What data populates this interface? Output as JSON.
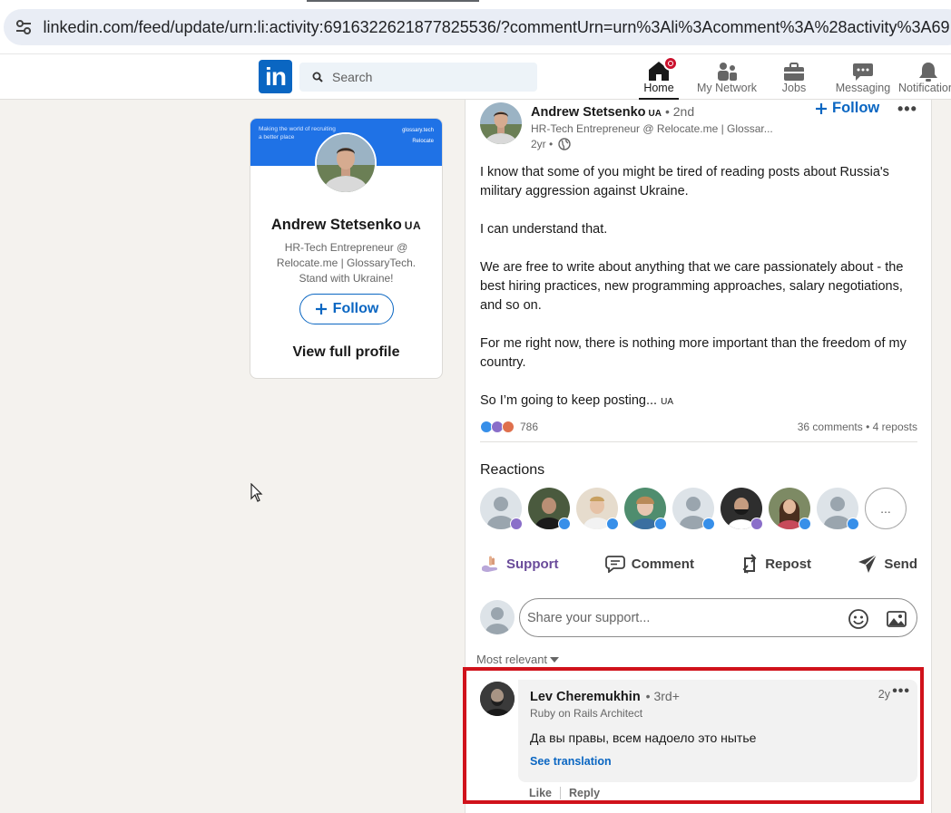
{
  "browser": {
    "url": "linkedin.com/feed/update/urn:li:activity:6916322621877825536/?commentUrn=urn%3Ali%3Acomment%3A%28activity%3A69163"
  },
  "nav": {
    "logo": "in",
    "search_placeholder": "Search",
    "items": [
      {
        "label": "Home",
        "icon": "home-icon",
        "active": true
      },
      {
        "label": "My Network",
        "icon": "network-icon"
      },
      {
        "label": "Jobs",
        "icon": "briefcase-icon"
      },
      {
        "label": "Messaging",
        "icon": "messaging-icon"
      },
      {
        "label": "Notifications",
        "icon": "bell-icon"
      }
    ]
  },
  "profile_card": {
    "banner_left": "Making the world of recruiting a better place",
    "banner_right_top": "glossary.tech",
    "banner_right_bottom": "Relocate",
    "name": "Andrew Stetsenko",
    "flag": "UA",
    "headline": "HR-Tech Entrepreneur @ Relocate.me | GlossaryTech. Stand with Ukraine!",
    "follow_label": "Follow",
    "view_profile_label": "View full profile"
  },
  "post": {
    "author": "Andrew Stetsenko",
    "flag": "UA",
    "degree": "• 2nd",
    "headline": "HR-Tech Entrepreneur @ Relocate.me | Glossar...",
    "time": "2yr •",
    "follow_label": "Follow",
    "more": "•••",
    "paragraphs": [
      "I know that some of you might be tired of reading posts about Russia's military aggression against Ukraine.",
      "I can understand that.",
      "We are free to write about anything that we care passionately about - the best hiring practices, new programming approaches, salary negotiations, and so on.",
      "For me right now, there is nothing more important than the freedom of my country.",
      "So I’m going to keep posting..."
    ],
    "last_flag": "UA",
    "reaction_count": "786",
    "engagement": "36 comments • 4 reposts",
    "reactions_title": "Reactions",
    "reactors_more": "...",
    "actions": [
      "Support",
      "Comment",
      "Repost",
      "Send"
    ],
    "composer_placeholder": "Share your support...",
    "sort_label": "Most relevant"
  },
  "comment": {
    "author": "Lev Cheremukhin",
    "degree": "• 3rd+",
    "headline": "Ruby on Rails Architect",
    "time": "2y",
    "more": "•••",
    "text": "Да вы правы, всем надоело это нытье",
    "translate_label": "See translation",
    "like_label": "Like",
    "reply_label": "Reply"
  },
  "colors": {
    "brand": "#0a66c2",
    "highlight": "#d0121b",
    "support": "#6a4b9a"
  }
}
